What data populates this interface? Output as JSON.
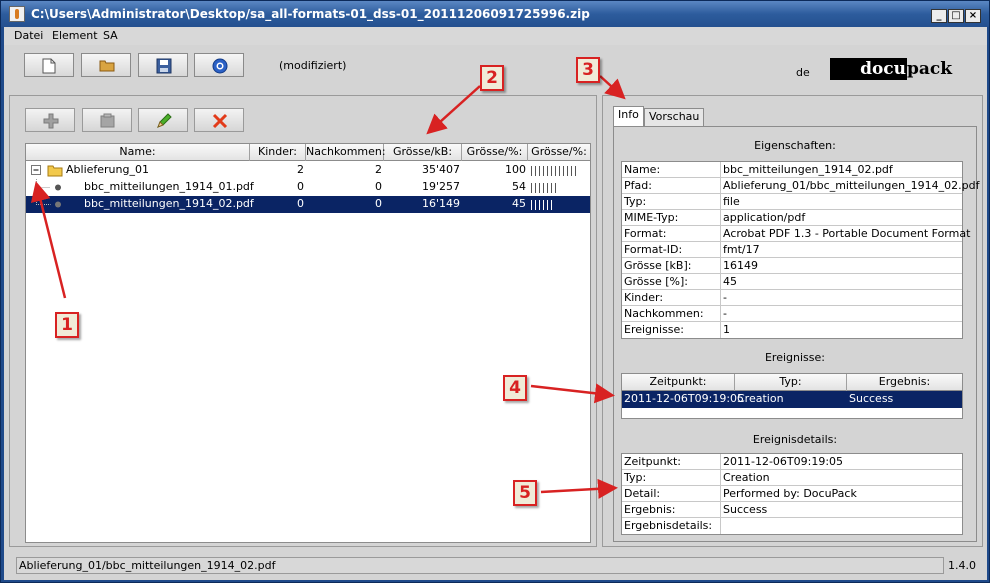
{
  "window": {
    "title": "C:\\Users\\Administrator\\Desktop/sa_all-formats-01_dss-01_20111206091725996.zip"
  },
  "menu": [
    "Datei",
    "Element",
    "SA"
  ],
  "toolbar": {
    "buttons": [
      {
        "icon": "new-document-icon"
      },
      {
        "icon": "open-folder-icon"
      },
      {
        "icon": "save-icon"
      },
      {
        "icon": "submit-icon"
      }
    ],
    "status": "(modifiziert)"
  },
  "language": "de",
  "logo": {
    "dark": "docu",
    "light": "pack"
  },
  "element_toolbar": [
    {
      "icon": "add-icon"
    },
    {
      "icon": "folder-icon"
    },
    {
      "icon": "edit-pencil-icon"
    },
    {
      "icon": "delete-icon"
    }
  ],
  "tree_table": {
    "headers": [
      "Name:",
      "Kinder:",
      "Nachkommen:",
      "Grösse/kB:",
      "Grösse/%:",
      "Grösse/%:"
    ],
    "rows": [
      {
        "name": "Ablieferung_01",
        "kinder": "2",
        "nachkommen": "2",
        "groesse_kb": "35'407",
        "groesse_pct": "100",
        "pct_value": 100,
        "type": "folder",
        "expanded": true,
        "selected": false
      },
      {
        "name": "bbc_mitteilungen_1914_01.pdf",
        "kinder": "0",
        "nachkommen": "0",
        "groesse_kb": "19'257",
        "groesse_pct": "54",
        "pct_value": 54,
        "type": "file",
        "selected": false
      },
      {
        "name": "bbc_mitteilungen_1914_02.pdf",
        "kinder": "0",
        "nachkommen": "0",
        "groesse_kb": "16'149",
        "groesse_pct": "45",
        "pct_value": 45,
        "type": "file",
        "selected": true
      }
    ]
  },
  "tabs": [
    "Info",
    "Vorschau"
  ],
  "info": {
    "properties_title": "Eigenschaften:",
    "properties": [
      {
        "key": "Name:",
        "value": "bbc_mitteilungen_1914_02.pdf"
      },
      {
        "key": "Pfad:",
        "value": "Ablieferung_01/bbc_mitteilungen_1914_02.pdf"
      },
      {
        "key": "Typ:",
        "value": "file"
      },
      {
        "key": "MIME-Typ:",
        "value": "application/pdf"
      },
      {
        "key": "Format:",
        "value": "Acrobat PDF 1.3 - Portable Document Format"
      },
      {
        "key": "Format-ID:",
        "value": "fmt/17"
      },
      {
        "key": "Grösse [kB]:",
        "value": "16149"
      },
      {
        "key": "Grösse [%]:",
        "value": "45"
      },
      {
        "key": "Kinder:",
        "value": "-"
      },
      {
        "key": "Nachkommen:",
        "value": "-"
      },
      {
        "key": "Ereignisse:",
        "value": "1"
      }
    ],
    "events_title": "Ereignisse:",
    "events_headers": [
      "Zeitpunkt:",
      "Typ:",
      "Ergebnis:"
    ],
    "events": [
      {
        "zeitpunkt": "2011-12-06T09:19:05",
        "typ": "Creation",
        "ergebnis": "Success"
      }
    ],
    "details_title": "Ereignisdetails:",
    "details": [
      {
        "key": "Zeitpunkt:",
        "value": "2011-12-06T09:19:05"
      },
      {
        "key": "Typ:",
        "value": "Creation"
      },
      {
        "key": "Detail:",
        "value": "Performed by: DocuPack"
      },
      {
        "key": "Ergebnis:",
        "value": "Success"
      },
      {
        "key": "Ergebnisdetails:",
        "value": ""
      }
    ]
  },
  "statusbar": {
    "path": "Ablieferung_01/bbc_mitteilungen_1914_02.pdf",
    "version": "1.4.0"
  },
  "callouts": [
    "1",
    "2",
    "3",
    "4",
    "5"
  ],
  "colors": {
    "selection": "#0a2464",
    "callout": "#d82222",
    "titlebar": "#2d5c9d"
  }
}
